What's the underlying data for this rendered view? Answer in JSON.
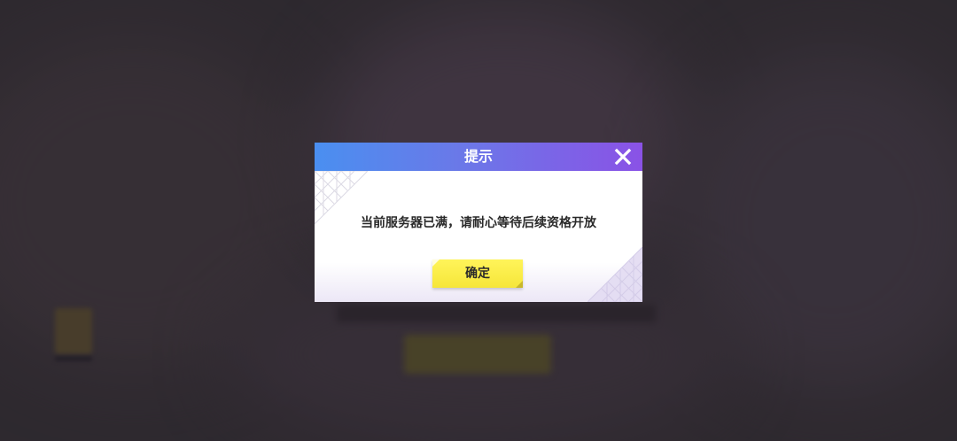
{
  "dialog": {
    "title": "提示",
    "message": "当前服务器已满，请耐心等待后续资格开放",
    "confirm_label": "确定",
    "close_icon": "close-icon"
  },
  "colors": {
    "header_start": "#4a8ff0",
    "header_end": "#8a52e6",
    "confirm_button": "#f6e63a",
    "overlay": "#3b363d"
  }
}
